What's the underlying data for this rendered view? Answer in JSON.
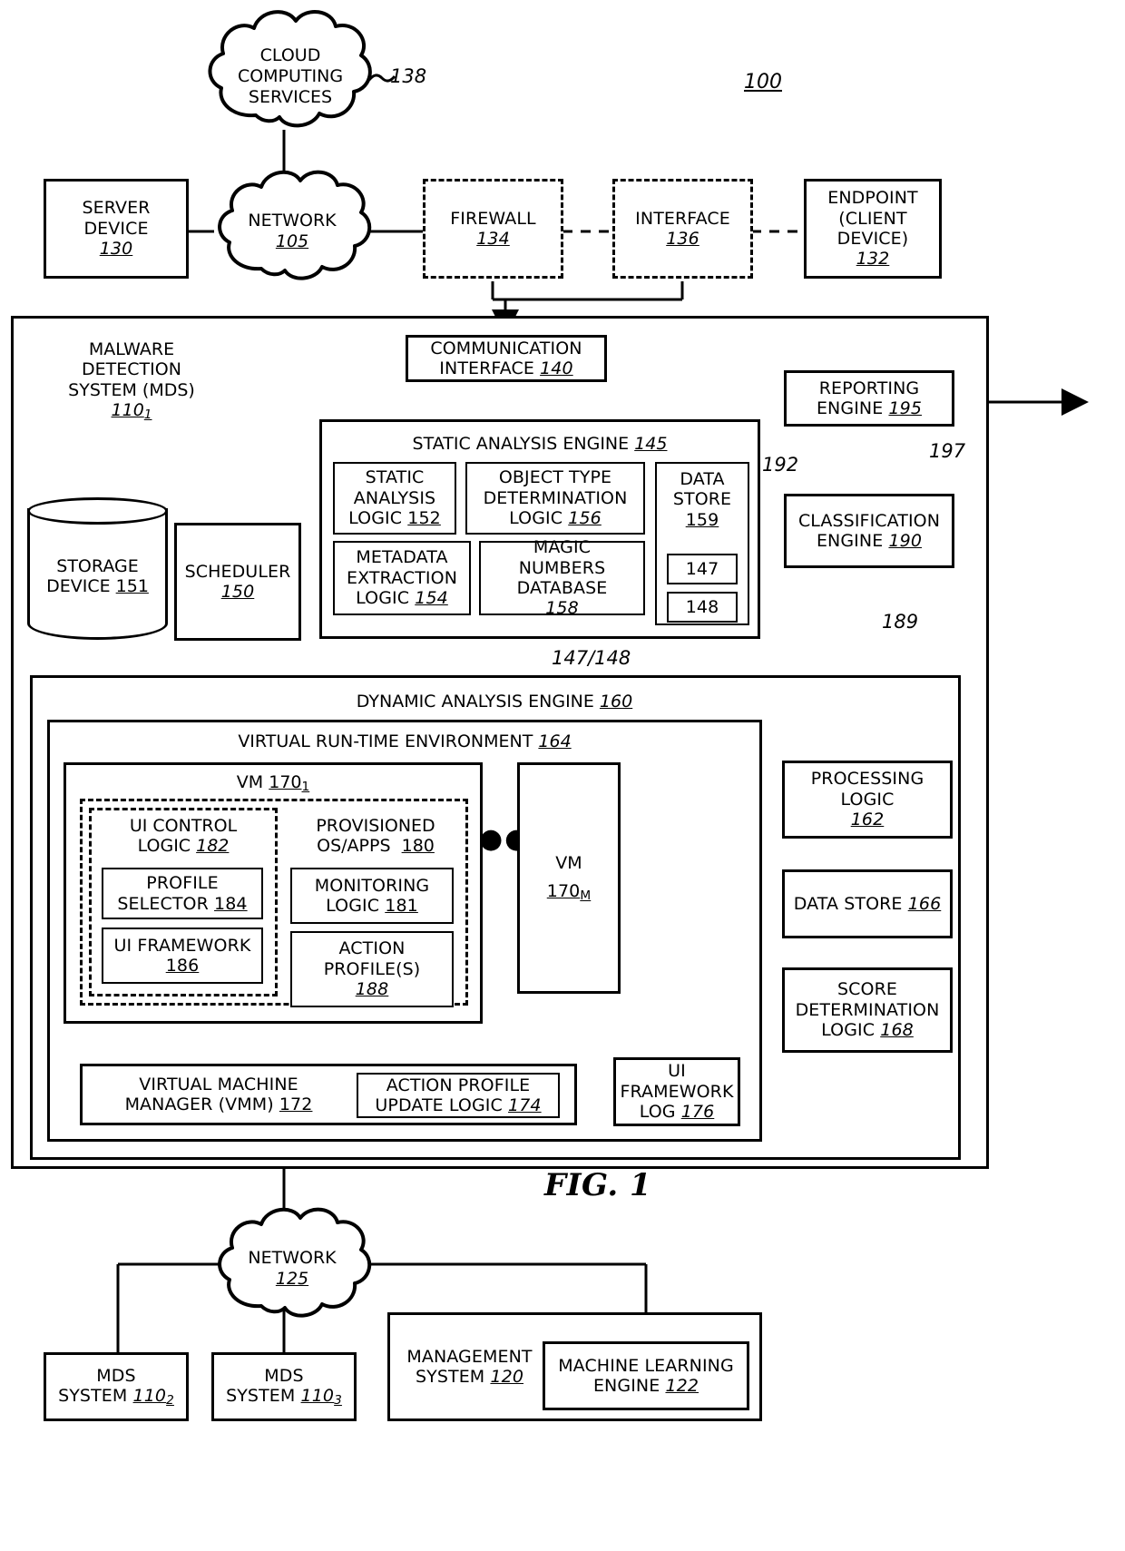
{
  "figure": {
    "title": "FIG. 1",
    "system_ref": "100"
  },
  "top_network": {
    "cloud_services": {
      "line1": "CLOUD",
      "line2": "COMPUTING",
      "line3": "SERVICES",
      "ref": "138"
    },
    "server_device": {
      "line1": "SERVER",
      "line2": "DEVICE",
      "ref": "130"
    },
    "network": {
      "line1": "NETWORK",
      "ref": "105"
    },
    "firewall": {
      "line1": "FIREWALL",
      "ref": "134"
    },
    "interface": {
      "line1": "INTERFACE",
      "ref": "136"
    },
    "endpoint": {
      "line1": "ENDPOINT",
      "line2": "(CLIENT",
      "line3": "DEVICE)",
      "ref": "132"
    }
  },
  "mds": {
    "title_line1": "MALWARE",
    "title_line2": "DETECTION",
    "title_line3": "SYSTEM (MDS)",
    "ref": "110",
    "ref_sub": "1",
    "communication_interface": {
      "line1": "COMMUNICATION",
      "line2": "INTERFACE",
      "ref": "140"
    },
    "storage_device": {
      "line1": "STORAGE",
      "line2": "DEVICE",
      "ref": "151"
    },
    "scheduler": {
      "line1": "SCHEDULER",
      "ref": "150"
    },
    "static_engine": {
      "title": "STATIC ANALYSIS ENGINE",
      "ref": "145",
      "static_analysis_logic": {
        "line1": "STATIC",
        "line2": "ANALYSIS",
        "line3": "LOGIC",
        "ref": "152"
      },
      "object_type_logic": {
        "line1": "OBJECT TYPE",
        "line2": "DETERMINATION",
        "line3": "LOGIC",
        "ref": "156"
      },
      "metadata_logic": {
        "line1": "METADATA",
        "line2": "EXTRACTION",
        "line3": "LOGIC",
        "ref": "154"
      },
      "magic_numbers_db": {
        "line1": "MAGIC",
        "line2": "NUMBERS",
        "line3": "DATABASE",
        "ref": "158"
      },
      "data_store": {
        "line1": "DATA",
        "line2": "STORE",
        "ref": "159",
        "item1": "147",
        "item2": "148"
      }
    },
    "static_to_dynamic_ref": "147/148",
    "reporting_engine": {
      "line1": "REPORTING",
      "line2": "ENGINE",
      "ref": "195"
    },
    "classification_engine": {
      "line1": "CLASSIFICATION",
      "line2": "ENGINE",
      "ref": "190"
    },
    "arrow_refs": {
      "out": "197",
      "class_to_report": "192",
      "dynamic_to_class": "189"
    },
    "dynamic_engine": {
      "title": "DYNAMIC ANALYSIS ENGINE",
      "ref": "160",
      "virtual_runtime": {
        "title": "VIRTUAL RUN-TIME ENVIRONMENT",
        "ref": "164",
        "vm1": {
          "title": "VM",
          "ref": "170",
          "ref_sub": "1",
          "ui_control_logic": {
            "line1": "UI CONTROL",
            "line2": "LOGIC",
            "ref": "182"
          },
          "profile_selector": {
            "line1": "PROFILE",
            "line2": "SELECTOR",
            "ref": "184"
          },
          "ui_framework": {
            "line1": "UI FRAMEWORK",
            "ref": "186"
          },
          "provisioned": {
            "line1": "PROVISIONED",
            "line2": "OS/APPS",
            "ref": "180"
          },
          "monitoring_logic": {
            "line1": "MONITORING",
            "line2": "LOGIC",
            "ref": "181"
          },
          "action_profiles": {
            "line1": "ACTION",
            "line2": "PROFILE(S)",
            "ref": "188"
          }
        },
        "ellipsis": "●●●",
        "vmM": {
          "title": "VM",
          "ref": "170",
          "ref_sub": "M"
        },
        "vmm": {
          "line1": "VIRTUAL MACHINE",
          "line2": "MANAGER (VMM)",
          "ref": "172"
        },
        "action_profile_update": {
          "line1": "ACTION PROFILE",
          "line2": "UPDATE LOGIC",
          "ref": "174"
        },
        "ui_framework_log": {
          "line1": "UI",
          "line2": "FRAMEWORK",
          "line3": "LOG",
          "ref": "176"
        }
      },
      "processing_logic": {
        "line1": "PROCESSING",
        "line2": "LOGIC",
        "ref": "162"
      },
      "data_store": {
        "line1": "DATA STORE",
        "ref": "166"
      },
      "score_logic": {
        "line1": "SCORE",
        "line2": "DETERMINATION",
        "line3": "LOGIC",
        "ref": "168"
      }
    }
  },
  "bottom_network": {
    "network": {
      "line1": "NETWORK",
      "ref": "125"
    },
    "mds2": {
      "line1": "MDS",
      "line2": "SYSTEM",
      "ref": "110",
      "ref_sub": "2"
    },
    "mds3": {
      "line1": "MDS",
      "line2": "SYSTEM",
      "ref": "110",
      "ref_sub": "3"
    },
    "management_system": {
      "line1": "MANAGEMENT",
      "line2": "SYSTEM",
      "ref": "120"
    },
    "ml_engine": {
      "line1": "MACHINE LEARNING",
      "line2": "ENGINE",
      "ref": "122"
    }
  }
}
